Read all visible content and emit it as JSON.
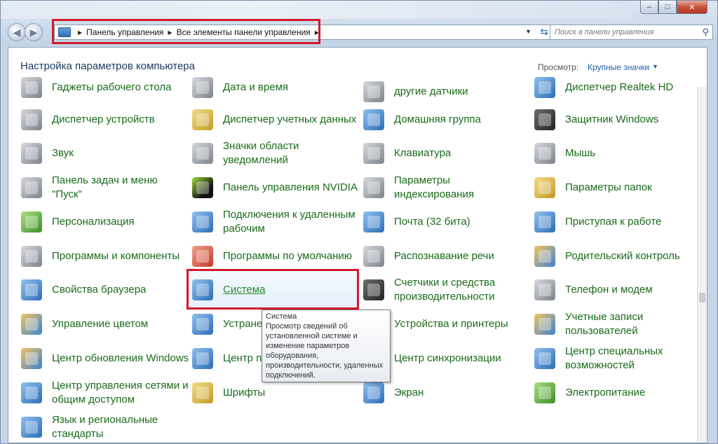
{
  "window": {
    "minimize": "–",
    "maximize": "□",
    "close": "✕"
  },
  "nav": {
    "back": "◀",
    "forward": "▶"
  },
  "address": {
    "crumbs": [
      "Панель управления",
      "Все элементы панели управления"
    ]
  },
  "search": {
    "placeholder": "Поиск в панели управления"
  },
  "header": {
    "title": "Настройка параметров компьютера",
    "view_label": "Просмотр:",
    "view_value": "Крупные значки"
  },
  "items": {
    "c1": [
      "Гаджеты рабочего стола",
      "Диспетчер устройств",
      "Звук",
      "Панель задач и меню \"Пуск\"",
      "Персонализация",
      "Программы и компоненты",
      "Свойства браузера",
      "Управление цветом",
      "Центр обновления Windows",
      "Центр управления сетями и общим доступом",
      "Язык и региональные стандарты"
    ],
    "c2": [
      "Дата и время",
      "Диспетчер учетных данных",
      "Значки области уведомлений",
      "Панель управления NVIDIA",
      "Подключения к удаленным рабочим",
      "Программы по умолчанию",
      "Система",
      "Устране",
      "Центр п",
      "Шрифты"
    ],
    "c3": [
      "другие датчики",
      "Домашняя группа",
      "Клавиатура",
      "Параметры индексирования",
      "Почта (32 бита)",
      "Распознавание речи",
      "Счетчики и средства производительности",
      "Устройства и принтеры",
      "Центр синхронизации",
      "Экран"
    ],
    "c4": [
      "Диспетчер Realtek HD",
      "Защитник Windows",
      "Мышь",
      "Параметры папок",
      "Приступая к работе",
      "Родительский контроль",
      "Телефон и модем",
      "Учетные записи пользователей",
      "Центр специальных возможностей",
      "Электропитание"
    ]
  },
  "tooltip": {
    "title": "Система",
    "text": "Просмотр сведений об установленной системе и изменение параметров оборудования, производительности, удаленных подключений."
  }
}
